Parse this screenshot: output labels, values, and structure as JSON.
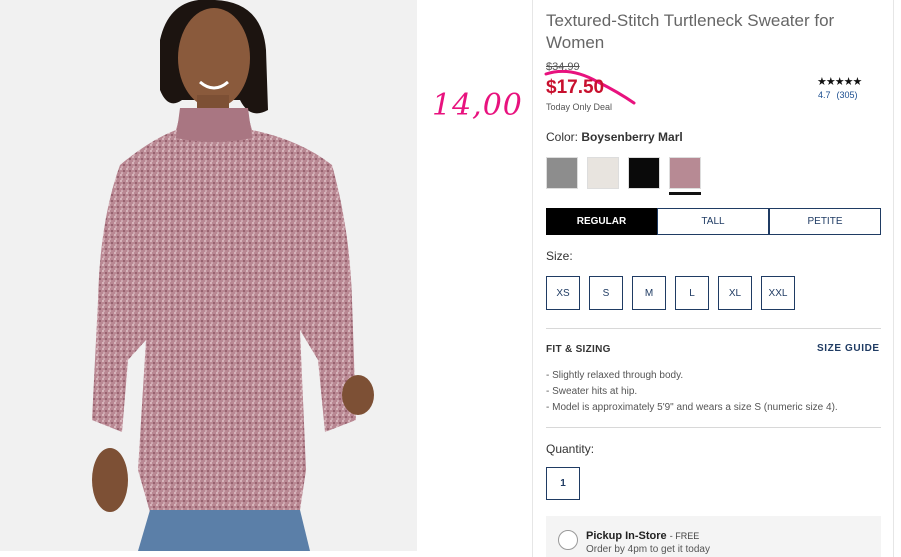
{
  "product": {
    "title": "Textured-Stitch Turtleneck Sweater for Women",
    "old_price": "$34.99",
    "sale_price": "$17.50",
    "deal_text": "Today Only Deal",
    "stars": "★★★★★",
    "rating_value": "4.7",
    "rating_count": "(305)"
  },
  "annotation": {
    "handwritten_price": "14,00",
    "color": "#e8127e"
  },
  "color": {
    "label": "Color:",
    "selected": "Boysenberry Marl",
    "swatches": [
      {
        "name": "heather-gray",
        "color": "#8d8d8d"
      },
      {
        "name": "oatmeal",
        "color": "#e8e4df"
      },
      {
        "name": "black",
        "color": "#0a0a0a"
      },
      {
        "name": "boysenberry-marl",
        "color": "#b78a94",
        "selected": true
      }
    ]
  },
  "fit_tabs": [
    "REGULAR",
    "TALL",
    "PETITE"
  ],
  "active_fit": "REGULAR",
  "size": {
    "label": "Size:",
    "options": [
      "XS",
      "S",
      "M",
      "L",
      "XL",
      "XXL"
    ]
  },
  "fit_sizing": {
    "heading": "FIT & SIZING",
    "size_guide": "SIZE GUIDE",
    "bullets": [
      "Slightly relaxed through body.",
      "Sweater hits at hip.",
      "Model is approximately 5'9\" and wears a size S (numeric size 4)."
    ]
  },
  "quantity": {
    "label": "Quantity:",
    "value": "1"
  },
  "pickup": {
    "title": "Pickup In-Store",
    "free": "- FREE",
    "sub": "Order by 4pm to get it today"
  }
}
